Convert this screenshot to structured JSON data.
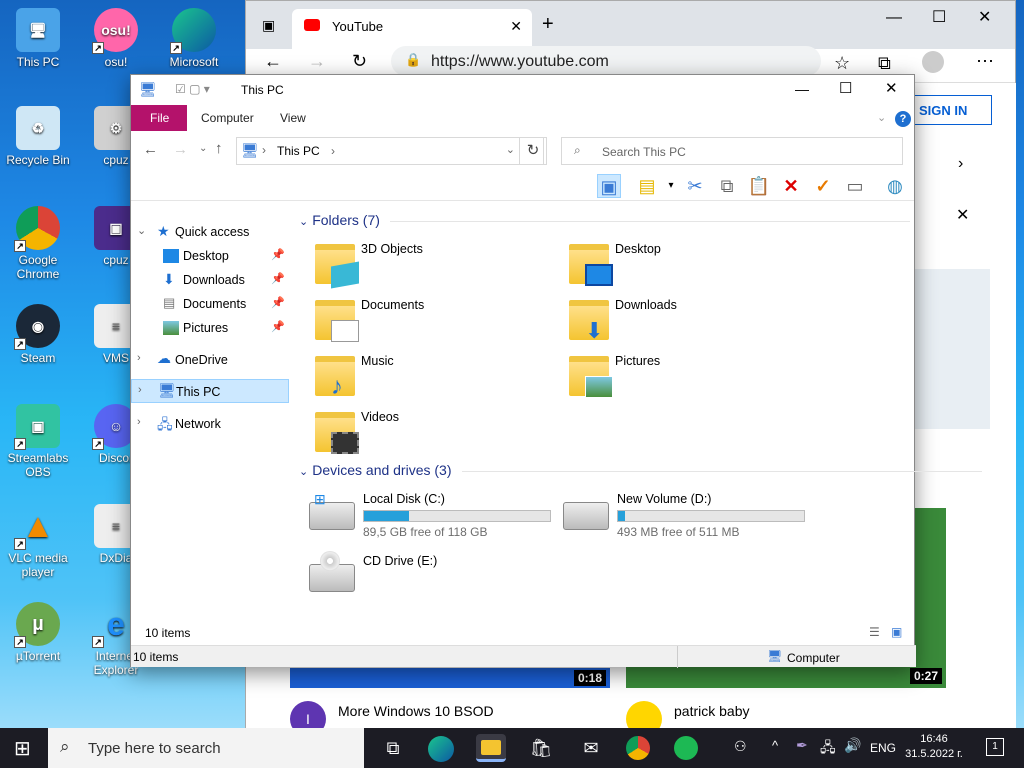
{
  "desktop": {
    "icons": [
      {
        "label": "This PC"
      },
      {
        "label": "osu!"
      },
      {
        "label": "Microsoft"
      },
      {
        "label": "Recycle Bin"
      },
      {
        "label": "cpuz"
      },
      {
        "label": "Google Chrome"
      },
      {
        "label": "cpuz"
      },
      {
        "label": "Steam"
      },
      {
        "label": "VMS"
      },
      {
        "label": "Streamlabs OBS"
      },
      {
        "label": "Discor"
      },
      {
        "label": "VLC media player"
      },
      {
        "label": "DxDia"
      },
      {
        "label": "µTorrent"
      },
      {
        "label": "Internet Explorer"
      }
    ]
  },
  "browser": {
    "tab_title": "YouTube",
    "url": "https://www.youtube.com",
    "sign_in": "SIGN IN",
    "videos": [
      {
        "duration": "0:18",
        "title": "More Windows 10 BSOD",
        "avatar": "I"
      },
      {
        "duration": "0:27",
        "title": "patrick baby"
      }
    ]
  },
  "explorer": {
    "title": "This PC",
    "ribbon_tabs": [
      "File",
      "Computer",
      "View"
    ],
    "address": "This PC",
    "search_placeholder": "Search This PC",
    "nav": {
      "quick_access": "Quick access",
      "items": [
        "Desktop",
        "Downloads",
        "Documents",
        "Pictures"
      ],
      "onedrive": "OneDrive",
      "this_pc": "This PC",
      "network": "Network"
    },
    "folders_header": "Folders (7)",
    "folders": [
      "3D Objects",
      "Desktop",
      "Documents",
      "Downloads",
      "Music",
      "Pictures",
      "Videos"
    ],
    "drives_header": "Devices and drives (3)",
    "drives": [
      {
        "name": "Local Disk (C:)",
        "free": "89,5 GB free of 118 GB",
        "used_fraction": 0.24
      },
      {
        "name": "New Volume (D:)",
        "free": "493 MB free of 511 MB",
        "used_fraction": 0.035
      },
      {
        "name": "CD Drive (E:)"
      }
    ],
    "item_count": "10 items",
    "status_items": "10 items",
    "status_location": "Computer"
  },
  "taskbar": {
    "search_placeholder": "Type here to search",
    "language": "ENG",
    "time": "16:46",
    "date": "31.5.2022 г.",
    "notifications": "1"
  },
  "colors": {
    "file_tab": "#b4126b",
    "drive_fill": "#26a0da",
    "selection": "#cce8ff"
  }
}
